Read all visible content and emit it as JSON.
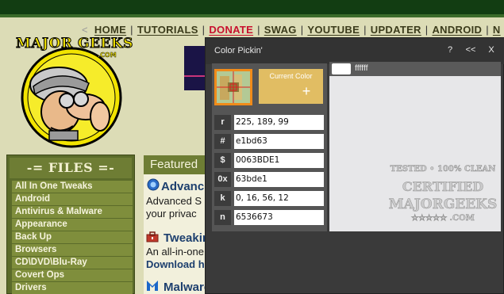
{
  "site": {
    "nav": [
      "HOME",
      "TUTORIALS",
      "DONATE",
      "SWAG",
      "YOUTUBE",
      "UPDATER",
      "ANDROID",
      "N"
    ],
    "logo_text": "MAJOR GEEKS",
    "logo_com": ".COM",
    "files_title": "-= FILES =-",
    "sidebar_items": [
      "All In One Tweaks",
      "Android",
      "Antivirus & Malware",
      "Appearance",
      "Back Up",
      "Browsers",
      "CD\\DVD\\Blu-Ray",
      "Covert Ops",
      "Drivers"
    ],
    "featured_label": "Featured",
    "articles": {
      "a1_title": "Advanc",
      "a1_line1": "Advanced S",
      "a1_line2": "your privac",
      "a2_title": "Tweaking.com - Windows Repair",
      "a2_line1": "An all-in-one repair tool to help fix a large majority of known Windo",
      "a2_link": "Download here.",
      "a3_title": "Malwarebytes"
    },
    "watermark": [
      "TESTED • 100% CLEAN",
      "CERTIFIED",
      "MAJORGEEKS",
      "★★★★★ .COM"
    ]
  },
  "picker": {
    "title": "Color Pickin'",
    "controls": {
      "help": "?",
      "collapse": "<<",
      "close": "X"
    },
    "current_color_label": "Current Color",
    "current_color_plus": "+",
    "current_color_hex": "#e1bd63",
    "rows": [
      {
        "label": "r",
        "value": "225, 189, 99"
      },
      {
        "label": "#",
        "value": "e1bd63"
      },
      {
        "label": "$",
        "value": "0063BDE1"
      },
      {
        "label": "0x",
        "value": "63bde1"
      },
      {
        "label": "k",
        "value": "0, 16, 56, 12"
      },
      {
        "label": "n",
        "value": "6536673"
      }
    ],
    "history": [
      {
        "swatch": "#ffffff",
        "label": "ffffff"
      }
    ]
  },
  "colors": {
    "accent_orange": "#f08b1a",
    "site_green": "#6e7d34",
    "donate_red": "#c8102e",
    "link_blue": "#1d3f6e"
  }
}
